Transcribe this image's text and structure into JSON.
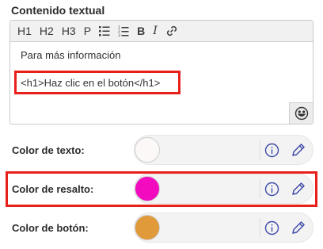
{
  "section": {
    "title": "Contenido textual"
  },
  "toolbar": {
    "h1": "H1",
    "h2": "H2",
    "h3": "H3",
    "p": "P",
    "bold": "B",
    "italic": "I",
    "icons": [
      "bullet-list-icon",
      "numbered-list-icon",
      "link-icon"
    ]
  },
  "editor": {
    "line1": "Para más información",
    "line2": "<h1>Haz clic en el botón</h1>",
    "emoji_icon": "smiley-icon"
  },
  "colors": {
    "text": {
      "label": "Color de texto:",
      "value": "#fdf8f8"
    },
    "highlight": {
      "label": "Color de resalto:",
      "value": "#f20bbf"
    },
    "button": {
      "label": "Color de botón:",
      "value": "#e19a3a"
    }
  },
  "accent": "#3e4aa8",
  "highlight_border": "#e8201a"
}
